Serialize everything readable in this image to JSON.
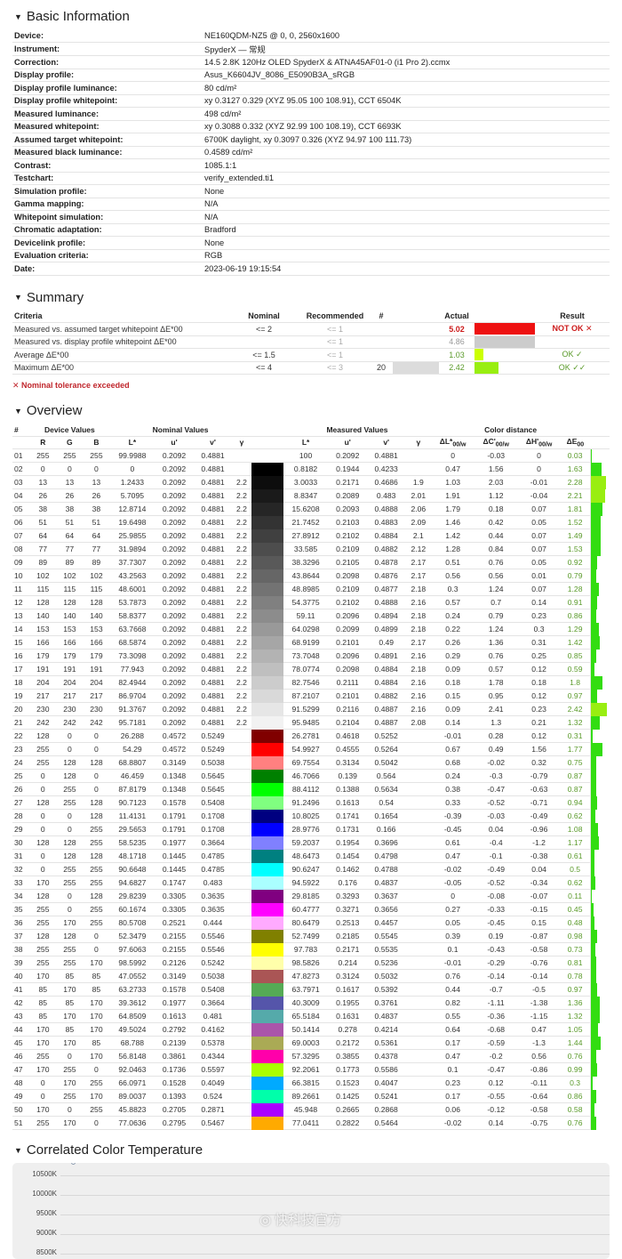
{
  "basic": {
    "title": "Basic Information",
    "rows": [
      {
        "k": "Device:",
        "v": "NE160QDM-NZ5 @ 0, 0, 2560x1600"
      },
      {
        "k": "Instrument:",
        "v": "SpyderX — 常规"
      },
      {
        "k": "Correction:",
        "v": "14.5 2.8K 120Hz OLED SpyderX & ATNA45AF01-0 (i1 Pro 2).ccmx"
      },
      {
        "k": "Display profile:",
        "v": "Asus_K6604JV_8086_E5090B3A_sRGB"
      },
      {
        "k": "Display profile luminance:",
        "v": "80 cd/m²"
      },
      {
        "k": "Display profile whitepoint:",
        "v": "xy 0.3127 0.329 (XYZ 95.05 100 108.91), CCT 6504K"
      },
      {
        "k": "Measured luminance:",
        "v": "498 cd/m²"
      },
      {
        "k": "Measured whitepoint:",
        "v": "xy 0.3088 0.332 (XYZ 92.99 100 108.19), CCT 6693K"
      },
      {
        "k": "Assumed target whitepoint:",
        "v": "6700K daylight, xy 0.3097 0.326 (XYZ 94.97 100 111.73)"
      },
      {
        "k": "Measured black luminance:",
        "v": "0.4589 cd/m²"
      },
      {
        "k": "Contrast:",
        "v": "1085.1:1"
      },
      {
        "k": "Testchart:",
        "v": "verify_extended.ti1"
      },
      {
        "k": "Simulation profile:",
        "v": "None"
      },
      {
        "k": "Gamma mapping:",
        "v": "N/A"
      },
      {
        "k": "Whitepoint simulation:",
        "v": "N/A"
      },
      {
        "k": "Chromatic adaptation:",
        "v": "Bradford"
      },
      {
        "k": "Devicelink profile:",
        "v": "None"
      },
      {
        "k": "Evaluation criteria:",
        "v": "RGB"
      },
      {
        "k": "Date:",
        "v": "2023-06-19 19:15:54"
      }
    ]
  },
  "summary": {
    "title": "Summary",
    "headers": {
      "criteria": "Criteria",
      "nominal": "Nominal",
      "recommended": "Recommended",
      "hash": "#",
      "actual": "Actual",
      "result": "Result"
    },
    "rows": [
      {
        "criteria": "Measured vs. assumed target whitepoint ΔE*00",
        "nominal": "<= 2",
        "recommended": "<= 1",
        "hash": "",
        "actual": "5.02",
        "bar_fraction": 1.0,
        "bar_color": "#ee1111",
        "result": "NOT OK ✕",
        "status": "bad"
      },
      {
        "criteria": "Measured vs. display profile whitepoint ΔE*00",
        "nominal": "",
        "recommended": "<= 1",
        "hash": "",
        "actual": "4.86",
        "bar_fraction": 1.0,
        "bar_color": "#cccccc",
        "result": "",
        "status": "gray"
      },
      {
        "criteria": "Average ΔE*00",
        "nominal": "<= 1.5",
        "recommended": "<= 1",
        "hash": "",
        "actual": "1.03",
        "bar_fraction": 0.15,
        "bar_color": "#ccff00",
        "result": "OK ✓",
        "status": "good"
      },
      {
        "criteria": "Maximum ΔE*00",
        "nominal": "<= 4",
        "recommended": "<= 3",
        "hash": "20",
        "actual": "2.42",
        "bar_fraction": 0.4,
        "bar_color": "#99ee11",
        "result": "OK ✓✓",
        "status": "good"
      }
    ],
    "note": "✕ Nominal tolerance exceeded"
  },
  "overview": {
    "title": "Overview",
    "group_headers": {
      "num": "#",
      "device": "Device Values",
      "nominal": "Nominal Values",
      "measured": "Measured Values",
      "distance": "Color distance"
    },
    "col_headers": {
      "r": "R",
      "g": "G",
      "b": "B",
      "l": "L*",
      "u": "u'",
      "v": "v'",
      "gamma": "γ",
      "dl": "ΔL*",
      "dc": "ΔC'",
      "dh": "ΔH'",
      "de": "ΔE",
      "sub_w": "00/w",
      "sub": "00"
    },
    "rows": [
      [
        "01",
        "255",
        "255",
        "255",
        "99.9988",
        "0.2092",
        "0.4881",
        "",
        "100",
        "0.2092",
        "0.4881",
        "",
        "0",
        "-0.03",
        "0",
        "0.03"
      ],
      [
        "02",
        "0",
        "0",
        "0",
        "0",
        "0.2092",
        "0.4881",
        "",
        "0.8182",
        "0.1944",
        "0.4233",
        "",
        "0.47",
        "1.56",
        "0",
        "1.63"
      ],
      [
        "03",
        "13",
        "13",
        "13",
        "1.2433",
        "0.2092",
        "0.4881",
        "2.2",
        "3.0033",
        "0.2171",
        "0.4686",
        "1.9",
        "1.03",
        "2.03",
        "-0.01",
        "2.28"
      ],
      [
        "04",
        "26",
        "26",
        "26",
        "5.7095",
        "0.2092",
        "0.4881",
        "2.2",
        "8.8347",
        "0.2089",
        "0.483",
        "2.01",
        "1.91",
        "1.12",
        "-0.04",
        "2.21"
      ],
      [
        "05",
        "38",
        "38",
        "38",
        "12.8714",
        "0.2092",
        "0.4881",
        "2.2",
        "15.6208",
        "0.2093",
        "0.4888",
        "2.06",
        "1.79",
        "0.18",
        "0.07",
        "1.81"
      ],
      [
        "06",
        "51",
        "51",
        "51",
        "19.6498",
        "0.2092",
        "0.4881",
        "2.2",
        "21.7452",
        "0.2103",
        "0.4883",
        "2.09",
        "1.46",
        "0.42",
        "0.05",
        "1.52"
      ],
      [
        "07",
        "64",
        "64",
        "64",
        "25.9855",
        "0.2092",
        "0.4881",
        "2.2",
        "27.8912",
        "0.2102",
        "0.4884",
        "2.1",
        "1.42",
        "0.44",
        "0.07",
        "1.49"
      ],
      [
        "08",
        "77",
        "77",
        "77",
        "31.9894",
        "0.2092",
        "0.4881",
        "2.2",
        "33.585",
        "0.2109",
        "0.4882",
        "2.12",
        "1.28",
        "0.84",
        "0.07",
        "1.53"
      ],
      [
        "09",
        "89",
        "89",
        "89",
        "37.7307",
        "0.2092",
        "0.4881",
        "2.2",
        "38.3296",
        "0.2105",
        "0.4878",
        "2.17",
        "0.51",
        "0.76",
        "0.05",
        "0.92"
      ],
      [
        "10",
        "102",
        "102",
        "102",
        "43.2563",
        "0.2092",
        "0.4881",
        "2.2",
        "43.8644",
        "0.2098",
        "0.4876",
        "2.17",
        "0.56",
        "0.56",
        "0.01",
        "0.79"
      ],
      [
        "11",
        "115",
        "115",
        "115",
        "48.6001",
        "0.2092",
        "0.4881",
        "2.2",
        "48.8985",
        "0.2109",
        "0.4877",
        "2.18",
        "0.3",
        "1.24",
        "0.07",
        "1.28"
      ],
      [
        "12",
        "128",
        "128",
        "128",
        "53.7873",
        "0.2092",
        "0.4881",
        "2.2",
        "54.3775",
        "0.2102",
        "0.4888",
        "2.16",
        "0.57",
        "0.7",
        "0.14",
        "0.91"
      ],
      [
        "13",
        "140",
        "140",
        "140",
        "58.8377",
        "0.2092",
        "0.4881",
        "2.2",
        "59.11",
        "0.2096",
        "0.4894",
        "2.18",
        "0.24",
        "0.79",
        "0.23",
        "0.86"
      ],
      [
        "14",
        "153",
        "153",
        "153",
        "63.7668",
        "0.2092",
        "0.4881",
        "2.2",
        "64.0298",
        "0.2099",
        "0.4899",
        "2.18",
        "0.22",
        "1.24",
        "0.3",
        "1.29"
      ],
      [
        "15",
        "166",
        "166",
        "166",
        "68.5874",
        "0.2092",
        "0.4881",
        "2.2",
        "68.9199",
        "0.2101",
        "0.49",
        "2.17",
        "0.26",
        "1.36",
        "0.31",
        "1.42"
      ],
      [
        "16",
        "179",
        "179",
        "179",
        "73.3098",
        "0.2092",
        "0.4881",
        "2.2",
        "73.7048",
        "0.2096",
        "0.4891",
        "2.16",
        "0.29",
        "0.76",
        "0.25",
        "0.85"
      ],
      [
        "17",
        "191",
        "191",
        "191",
        "77.943",
        "0.2092",
        "0.4881",
        "2.2",
        "78.0774",
        "0.2098",
        "0.4884",
        "2.18",
        "0.09",
        "0.57",
        "0.12",
        "0.59"
      ],
      [
        "18",
        "204",
        "204",
        "204",
        "82.4944",
        "0.2092",
        "0.4881",
        "2.2",
        "82.7546",
        "0.2111",
        "0.4884",
        "2.16",
        "0.18",
        "1.78",
        "0.18",
        "1.8"
      ],
      [
        "19",
        "217",
        "217",
        "217",
        "86.9704",
        "0.2092",
        "0.4881",
        "2.2",
        "87.2107",
        "0.2101",
        "0.4882",
        "2.16",
        "0.15",
        "0.95",
        "0.12",
        "0.97"
      ],
      [
        "20",
        "230",
        "230",
        "230",
        "91.3767",
        "0.2092",
        "0.4881",
        "2.2",
        "91.5299",
        "0.2116",
        "0.4887",
        "2.16",
        "0.09",
        "2.41",
        "0.23",
        "2.42"
      ],
      [
        "21",
        "242",
        "242",
        "242",
        "95.7181",
        "0.2092",
        "0.4881",
        "2.2",
        "95.9485",
        "0.2104",
        "0.4887",
        "2.08",
        "0.14",
        "1.3",
        "0.21",
        "1.32"
      ],
      [
        "22",
        "128",
        "0",
        "0",
        "26.288",
        "0.4572",
        "0.5249",
        "",
        "26.2781",
        "0.4618",
        "0.5252",
        "",
        "-0.01",
        "0.28",
        "0.12",
        "0.31"
      ],
      [
        "23",
        "255",
        "0",
        "0",
        "54.29",
        "0.4572",
        "0.5249",
        "",
        "54.9927",
        "0.4555",
        "0.5264",
        "",
        "0.67",
        "0.49",
        "1.56",
        "1.77"
      ],
      [
        "24",
        "255",
        "128",
        "128",
        "68.8807",
        "0.3149",
        "0.5038",
        "",
        "69.7554",
        "0.3134",
        "0.5042",
        "",
        "0.68",
        "-0.02",
        "0.32",
        "0.75"
      ],
      [
        "25",
        "0",
        "128",
        "0",
        "46.459",
        "0.1348",
        "0.5645",
        "",
        "46.7066",
        "0.139",
        "0.564",
        "",
        "0.24",
        "-0.3",
        "-0.79",
        "0.87"
      ],
      [
        "26",
        "0",
        "255",
        "0",
        "87.8179",
        "0.1348",
        "0.5645",
        "",
        "88.4112",
        "0.1388",
        "0.5634",
        "",
        "0.38",
        "-0.47",
        "-0.63",
        "0.87"
      ],
      [
        "27",
        "128",
        "255",
        "128",
        "90.7123",
        "0.1578",
        "0.5408",
        "",
        "91.2496",
        "0.1613",
        "0.54",
        "",
        "0.33",
        "-0.52",
        "-0.71",
        "0.94"
      ],
      [
        "28",
        "0",
        "0",
        "128",
        "11.4131",
        "0.1791",
        "0.1708",
        "",
        "10.8025",
        "0.1741",
        "0.1654",
        "",
        "-0.39",
        "-0.03",
        "-0.49",
        "0.62"
      ],
      [
        "29",
        "0",
        "0",
        "255",
        "29.5653",
        "0.1791",
        "0.1708",
        "",
        "28.9776",
        "0.1731",
        "0.166",
        "",
        "-0.45",
        "0.04",
        "-0.96",
        "1.08"
      ],
      [
        "30",
        "128",
        "128",
        "255",
        "58.5235",
        "0.1977",
        "0.3664",
        "",
        "59.2037",
        "0.1954",
        "0.3696",
        "",
        "0.61",
        "-0.4",
        "-1.2",
        "1.17"
      ],
      [
        "31",
        "0",
        "128",
        "128",
        "48.1718",
        "0.1445",
        "0.4785",
        "",
        "48.6473",
        "0.1454",
        "0.4798",
        "",
        "0.47",
        "-0.1",
        "-0.38",
        "0.61"
      ],
      [
        "32",
        "0",
        "255",
        "255",
        "90.6648",
        "0.1445",
        "0.4785",
        "",
        "90.6247",
        "0.1462",
        "0.4788",
        "",
        "-0.02",
        "-0.49",
        "0.04",
        "0.5"
      ],
      [
        "33",
        "170",
        "255",
        "255",
        "94.6827",
        "0.1747",
        "0.483",
        "",
        "94.5922",
        "0.176",
        "0.4837",
        "",
        "-0.05",
        "-0.52",
        "-0.34",
        "0.62"
      ],
      [
        "34",
        "128",
        "0",
        "128",
        "29.8239",
        "0.3305",
        "0.3635",
        "",
        "29.8185",
        "0.3293",
        "0.3637",
        "",
        "0",
        "-0.08",
        "-0.07",
        "0.11"
      ],
      [
        "35",
        "255",
        "0",
        "255",
        "60.1674",
        "0.3305",
        "0.3635",
        "",
        "60.4777",
        "0.3271",
        "0.3656",
        "",
        "0.27",
        "-0.33",
        "-0.15",
        "0.45"
      ],
      [
        "36",
        "255",
        "170",
        "255",
        "80.5708",
        "0.2521",
        "0.444",
        "",
        "80.6479",
        "0.2513",
        "0.4457",
        "",
        "0.05",
        "-0.45",
        "0.15",
        "0.48"
      ],
      [
        "37",
        "128",
        "128",
        "0",
        "52.3479",
        "0.2155",
        "0.5546",
        "",
        "52.7499",
        "0.2185",
        "0.5545",
        "",
        "0.39",
        "0.19",
        "-0.87",
        "0.98"
      ],
      [
        "38",
        "255",
        "255",
        "0",
        "97.6063",
        "0.2155",
        "0.5546",
        "",
        "97.783",
        "0.2171",
        "0.5535",
        "",
        "0.1",
        "-0.43",
        "-0.58",
        "0.73"
      ],
      [
        "39",
        "255",
        "255",
        "170",
        "98.5992",
        "0.2126",
        "0.5242",
        "",
        "98.5826",
        "0.214",
        "0.5236",
        "",
        "-0.01",
        "-0.29",
        "-0.76",
        "0.81"
      ],
      [
        "40",
        "170",
        "85",
        "85",
        "47.0552",
        "0.3149",
        "0.5038",
        "",
        "47.8273",
        "0.3124",
        "0.5032",
        "",
        "0.76",
        "-0.14",
        "-0.14",
        "0.78"
      ],
      [
        "41",
        "85",
        "170",
        "85",
        "63.2733",
        "0.1578",
        "0.5408",
        "",
        "63.7971",
        "0.1617",
        "0.5392",
        "",
        "0.44",
        "-0.7",
        "-0.5",
        "0.97"
      ],
      [
        "42",
        "85",
        "85",
        "170",
        "39.3612",
        "0.1977",
        "0.3664",
        "",
        "40.3009",
        "0.1955",
        "0.3761",
        "",
        "0.82",
        "-1.11",
        "-1.38",
        "1.36"
      ],
      [
        "43",
        "85",
        "170",
        "170",
        "64.8509",
        "0.1613",
        "0.481",
        "",
        "65.5184",
        "0.1631",
        "0.4837",
        "",
        "0.55",
        "-0.36",
        "-1.15",
        "1.32"
      ],
      [
        "44",
        "170",
        "85",
        "170",
        "49.5024",
        "0.2792",
        "0.4162",
        "",
        "50.1414",
        "0.278",
        "0.4214",
        "",
        "0.64",
        "-0.68",
        "0.47",
        "1.05"
      ],
      [
        "45",
        "170",
        "170",
        "85",
        "68.788",
        "0.2139",
        "0.5378",
        "",
        "69.0003",
        "0.2172",
        "0.5361",
        "",
        "0.17",
        "-0.59",
        "-1.3",
        "1.44"
      ],
      [
        "46",
        "255",
        "0",
        "170",
        "56.8148",
        "0.3861",
        "0.4344",
        "",
        "57.3295",
        "0.3855",
        "0.4378",
        "",
        "0.47",
        "-0.2",
        "0.56",
        "0.76"
      ],
      [
        "47",
        "170",
        "255",
        "0",
        "92.0463",
        "0.1736",
        "0.5597",
        "",
        "92.2061",
        "0.1773",
        "0.5586",
        "",
        "0.1",
        "-0.47",
        "-0.86",
        "0.99"
      ],
      [
        "48",
        "0",
        "170",
        "255",
        "66.0971",
        "0.1528",
        "0.4049",
        "",
        "66.3815",
        "0.1523",
        "0.4047",
        "",
        "0.23",
        "0.12",
        "-0.11",
        "0.3"
      ],
      [
        "49",
        "0",
        "255",
        "170",
        "89.0037",
        "0.1393",
        "0.524",
        "",
        "89.2661",
        "0.1425",
        "0.5241",
        "",
        "0.17",
        "-0.55",
        "-0.64",
        "0.86"
      ],
      [
        "50",
        "170",
        "0",
        "255",
        "45.8823",
        "0.2705",
        "0.2871",
        "",
        "45.948",
        "0.2665",
        "0.2868",
        "",
        "0.06",
        "-0.12",
        "-0.58",
        "0.58"
      ],
      [
        "51",
        "255",
        "170",
        "0",
        "77.0636",
        "0.2795",
        "0.5467",
        "",
        "77.0411",
        "0.2822",
        "0.5464",
        "",
        "-0.02",
        "0.14",
        "-0.75",
        "0.76"
      ]
    ]
  },
  "cct": {
    "title": "Correlated Color Temperature",
    "chart_data": {
      "type": "line",
      "title": "Correlated Color Temperature",
      "yticks": [
        "10500K",
        "10000K",
        "9500K",
        "9000K",
        "8500K"
      ],
      "ytick_values": [
        10500,
        10000,
        9500,
        9000,
        8500
      ],
      "grid": true
    }
  },
  "watermark": "快科技官方"
}
